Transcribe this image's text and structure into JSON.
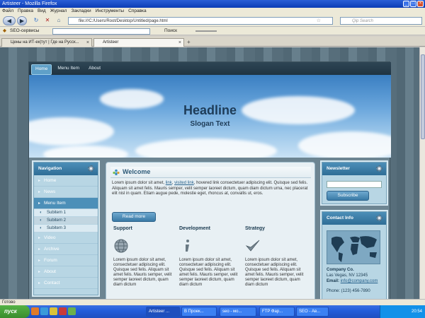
{
  "window": {
    "title": "Artisteer - Mozilla Firefox"
  },
  "menu": [
    "Файл",
    "Правка",
    "Вид",
    "Журнал",
    "Закладки",
    "Инструменты",
    "Справка"
  ],
  "nav": {
    "url": "file:///C:/Users/Root/Desktop/Untitled/page.html",
    "search_placeholder": "Qip Search"
  },
  "bookmarks": {
    "label": "SEO-сервисы",
    "tools": "Поиск"
  },
  "tabs": [
    {
      "label": "Цены на ИТ-ек|тут | Где на Русск..."
    },
    {
      "label": "Artisteer"
    }
  ],
  "site": {
    "topnav": [
      "Home",
      "Menu Item",
      "About"
    ],
    "headline": "Headline",
    "slogan": "Slogan Text",
    "navigation": {
      "title": "Navigation",
      "items": [
        "Home",
        "News",
        "Menu Item"
      ],
      "subitems": [
        "Subitem 1",
        "Subitem 2",
        "Subitem 3"
      ],
      "items2": [
        "Video",
        "Archive",
        "Forum",
        "About",
        "Contact"
      ]
    },
    "welcome": {
      "title": "Welcome",
      "text_before": "Lorem ipsum dolor sit amet, ",
      "link1": "link",
      "mid": ", ",
      "link2": "visited link",
      "text_after": ", hovered link consectetuer adipiscing elit. Quisque sed felis. Aliquam sit amet felis. Mauris semper, velit semper laoreet dictum, quam diam dictum urna, nec placerat elit nisl in quam. Etiam augue pede, molestie eget, rhoncus at, convallis ut, eros.",
      "read_more": "Read more"
    },
    "features": [
      {
        "title": "Support",
        "text": "Lorem ipsum dolor sit amet, consectetuer adipiscing elit. Quisque sed felis. Aliquam sit amet felis. Mauris semper, velit semper laoreet dictum, quam diam dictum"
      },
      {
        "title": "Development",
        "text": "Lorem ipsum dolor sit amet, consectetuer adipiscing elit. Quisque sed felis. Aliquam sit amet felis. Mauris semper, velit semper laoreet dictum, quam diam dictum"
      },
      {
        "title": "Strategy",
        "text": "Lorem ipsum dolor sit amet, consectetuer adipiscing elit. Quisque sed felis. Aliquam sit amet felis. Mauris semper, velit semper laoreet dictum, quam diam dictum"
      }
    ],
    "newsletter": {
      "title": "Newsletter",
      "button": "Subscribe"
    },
    "contact": {
      "title": "Contact Info",
      "company": "Company Co.",
      "address": "Las Vegas, NV 12345",
      "email_label": "Email: ",
      "email": "info@company.com",
      "phone": "Phone: (123) 456-7890"
    }
  },
  "status": "Готово",
  "taskbar": {
    "start": "пуск",
    "tasks": [
      "Artisteer ...",
      "В Проек...",
      "seo - мо...",
      "FTP Фар...",
      "SEO - Ав..."
    ],
    "clock": "20:54"
  }
}
